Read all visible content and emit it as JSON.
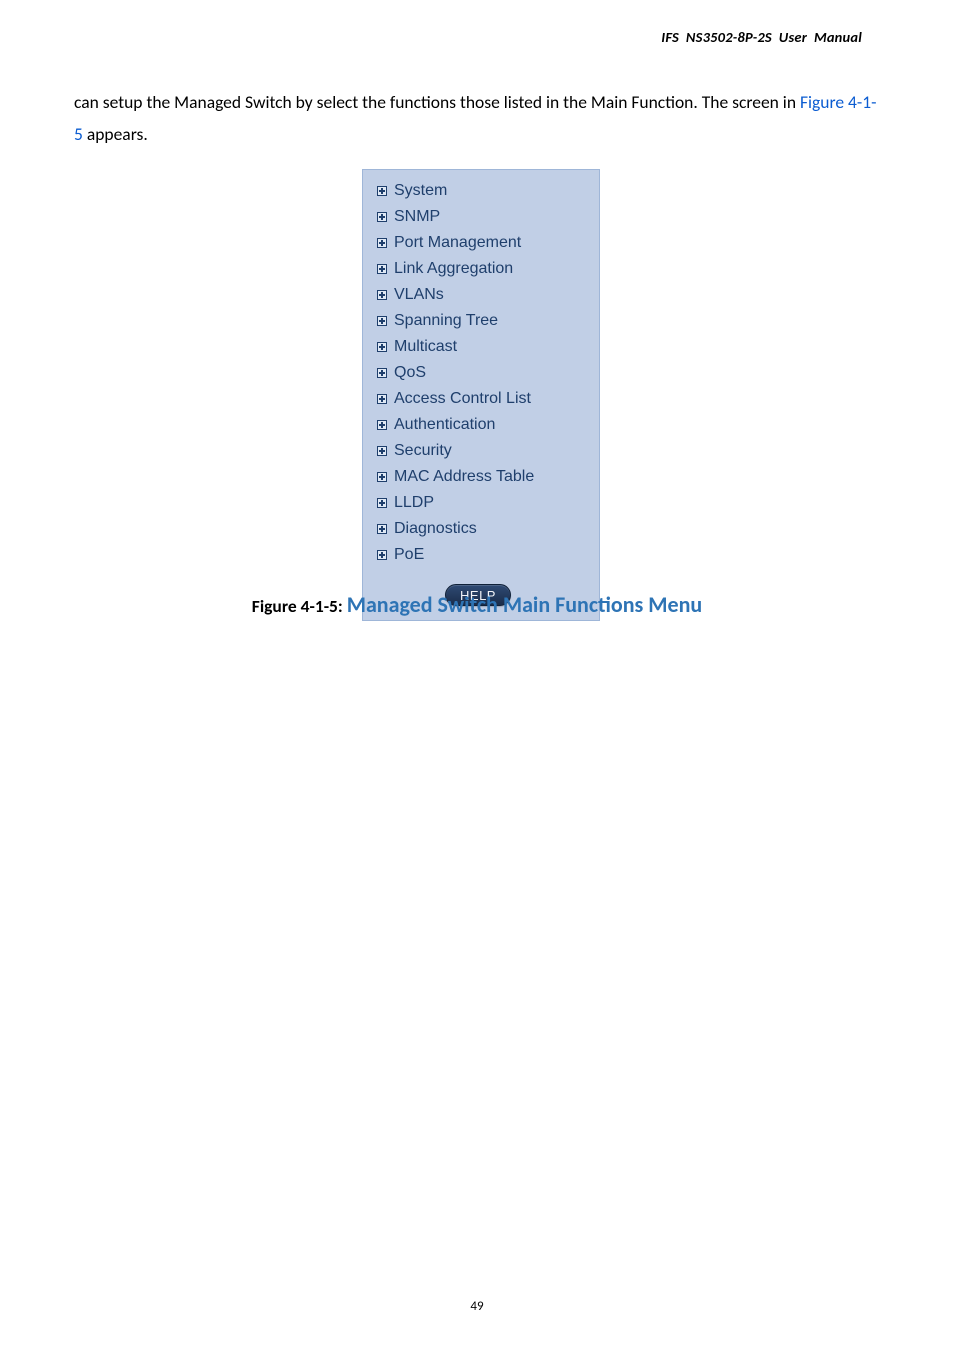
{
  "header": {
    "title": "IFS  NS3502-8P-2S  User  Manual"
  },
  "body": {
    "line1": "can setup the Managed Switch by select the functions those listed in the Main Function. The screen in ",
    "figref": "Figure 4-1-5",
    "line2_rest": " appears."
  },
  "menu": {
    "items": [
      "System",
      "SNMP",
      "Port Management",
      "Link Aggregation",
      "VLANs",
      "Spanning Tree",
      "Multicast",
      "QoS",
      "Access Control List",
      "Authentication",
      "Security",
      "MAC Address Table",
      "LLDP",
      "Diagnostics",
      "PoE"
    ],
    "help_label": "HELP"
  },
  "caption": {
    "label": "Figure 4-1-5: ",
    "title": "Managed Switch Main Functions Menu"
  },
  "footer": {
    "page_number": "49"
  }
}
